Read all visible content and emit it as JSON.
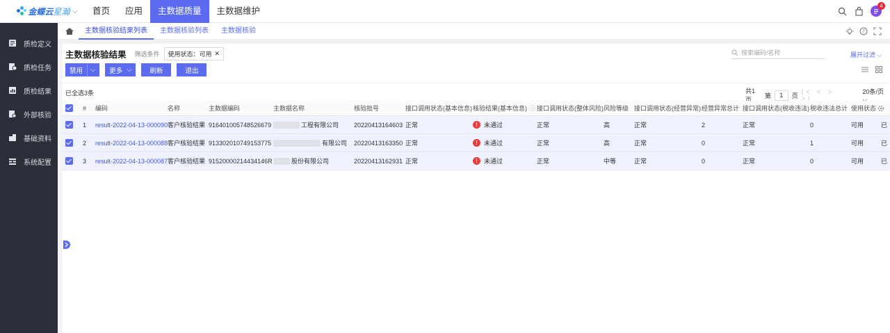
{
  "app": {
    "brand": "金蝶云",
    "brand_sub": "星瀚"
  },
  "topnav": [
    {
      "label": "首页",
      "active": false
    },
    {
      "label": "应用",
      "active": false
    },
    {
      "label": "主数据质量",
      "active": true
    },
    {
      "label": "主数据维护",
      "active": false
    }
  ],
  "header": {
    "notification_count": "4"
  },
  "sidebar": {
    "items": [
      {
        "label": "质检定义",
        "icon": "document-icon"
      },
      {
        "label": "质检任务",
        "icon": "task-icon"
      },
      {
        "label": "质检结果",
        "icon": "result-icon"
      },
      {
        "label": "外部核验",
        "icon": "verify-icon"
      },
      {
        "label": "基础资料",
        "icon": "building-icon"
      },
      {
        "label": "系统配置",
        "icon": "config-icon"
      }
    ]
  },
  "tabs": [
    {
      "label": "主数据核验结果列表",
      "active": true
    },
    {
      "label": "主数据核验列表",
      "active": false
    },
    {
      "label": "主数据核验",
      "active": false
    }
  ],
  "page": {
    "title": "主数据核验结果",
    "filter_label": "筛选条件",
    "filter_chip": "使用状态：可用",
    "search_placeholder": "搜索编码/名称",
    "expand_filter": "展开过滤"
  },
  "toolbar": {
    "disable_label": "禁用",
    "more_label": "更多",
    "refresh_label": "刷新",
    "exit_label": "退出"
  },
  "selection": {
    "info": "已全选3条"
  },
  "pager": {
    "total": "共1页",
    "page_prefix": "第",
    "page": "1",
    "page_suffix": "页",
    "nav": "|< < > >|",
    "page_size": "20条/页"
  },
  "table": {
    "columns": [
      "#",
      "编码",
      "名称",
      "主数据编码",
      "主数据名称",
      "核验批号",
      "接口调用状态(基本信息)",
      "核验结果(基本信息)",
      "接口调用状态(整体风险)",
      "风险等级",
      "接口调用状态(经营异常)",
      "经营异常总计",
      "接口调用状态(税收违法)",
      "税收违法总计",
      "使用状态"
    ],
    "rows": [
      {
        "idx": "1",
        "code": "result-2022-04-13-000090",
        "name": "客户核验结果",
        "md_code": "916401005748526679",
        "md_name": "工程有限公司",
        "batch": "20220413164603",
        "s_basic": "正常",
        "r_basic": "未通过",
        "s_risk": "正常",
        "risk_level": "高",
        "s_biz": "正常",
        "biz_total": "2",
        "s_tax": "正常",
        "tax_total": "0",
        "use": "可用",
        "extra": "已"
      },
      {
        "idx": "2",
        "code": "result-2022-04-13-000088",
        "name": "客户核验结果",
        "md_code": "913302010749153775",
        "md_name": "有限公司",
        "batch": "20220413163350",
        "s_basic": "正常",
        "r_basic": "未通过",
        "s_risk": "正常",
        "risk_level": "高",
        "s_biz": "正常",
        "biz_total": "0",
        "s_tax": "正常",
        "tax_total": "1",
        "use": "可用",
        "extra": "已"
      },
      {
        "idx": "3",
        "code": "result-2022-04-13-000087",
        "name": "客户核验结果",
        "md_code": "91520000214434146R",
        "md_name": "股份有限公司",
        "batch": "20220413162931",
        "s_basic": "正常",
        "r_basic": "未通过",
        "s_risk": "正常",
        "risk_level": "中等",
        "s_biz": "正常",
        "biz_total": "0",
        "s_tax": "正常",
        "tax_total": "0",
        "use": "可用",
        "extra": "已"
      }
    ]
  },
  "colors": {
    "accent": "#5b6cf0",
    "sidebar_bg": "#2c2f3a",
    "error": "#e63d3d",
    "row_selected": "#f0f2ff"
  }
}
